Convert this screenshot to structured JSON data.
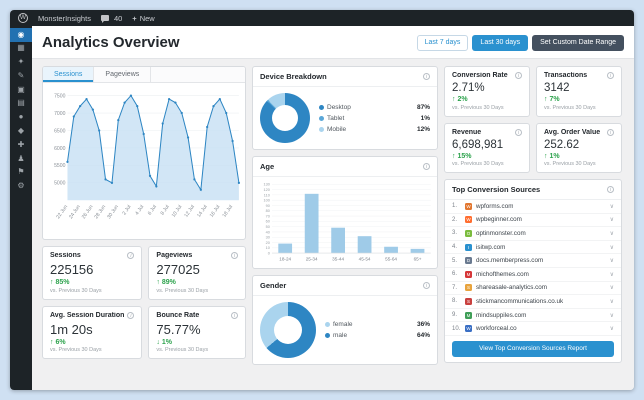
{
  "admin_bar": {
    "site_name": "MonsterInsights",
    "comments_count": "40",
    "new_label": "New"
  },
  "icons": {
    "wp": "W",
    "plus": "+",
    "info": "i",
    "chevron": "∨",
    "up_arrow": "↑",
    "down_arrow": "↓"
  },
  "sidebar": {
    "items": [
      {
        "name": "monsterinsights",
        "glyph": "◉",
        "active": true
      },
      {
        "name": "dashboard",
        "glyph": "▦",
        "active": false
      },
      {
        "name": "jetpack",
        "glyph": "✦",
        "active": false
      },
      {
        "name": "posts",
        "glyph": "✎",
        "active": false
      },
      {
        "name": "media",
        "glyph": "▣",
        "active": false
      },
      {
        "name": "pages",
        "glyph": "▤",
        "active": false
      },
      {
        "name": "comments",
        "glyph": "●",
        "active": false
      },
      {
        "name": "appearance",
        "glyph": "◆",
        "active": false
      },
      {
        "name": "plugins",
        "glyph": "✚",
        "active": false
      },
      {
        "name": "users",
        "glyph": "♟",
        "active": false
      },
      {
        "name": "tools",
        "glyph": "⚑",
        "active": false
      },
      {
        "name": "settings",
        "glyph": "⚙",
        "active": false
      }
    ]
  },
  "header": {
    "title": "Analytics Overview",
    "range_buttons": [
      {
        "label": "Last 7 days",
        "active": false
      },
      {
        "label": "Last 30 days",
        "active": true
      }
    ],
    "custom_range_label": "Set Custom Date Range"
  },
  "tabs": [
    {
      "label": "Sessions",
      "active": true
    },
    {
      "label": "Pageviews",
      "active": false
    }
  ],
  "stats": {
    "cards": [
      {
        "label": "Sessions",
        "value": "225156",
        "delta": "85%",
        "direction": "up",
        "compare": "vs. Previous 30 Days"
      },
      {
        "label": "Pageviews",
        "value": "277025",
        "delta": "89%",
        "direction": "up",
        "compare": "vs. Previous 30 Days"
      },
      {
        "label": "Avg. Session Duration",
        "value": "1m 20s",
        "delta": "6%",
        "direction": "up",
        "compare": "vs. Previous 30 Days"
      },
      {
        "label": "Bounce Rate",
        "value": "75.77%",
        "delta": "1%",
        "direction": "down",
        "compare": "vs. Previous 30 Days"
      }
    ]
  },
  "ecommerce": {
    "cards": [
      {
        "label": "Conversion Rate",
        "value": "2.71%",
        "delta": "2%",
        "direction": "up",
        "compare": "vs. Previous 30 Days"
      },
      {
        "label": "Transactions",
        "value": "3142",
        "delta": "7%",
        "direction": "up",
        "compare": "vs. Previous 30 Days"
      },
      {
        "label": "Revenue",
        "value": "6,698,981",
        "delta": "15%",
        "direction": "up",
        "compare": "vs. Previous 30 Days"
      },
      {
        "label": "Avg. Order Value",
        "value": "252.62",
        "delta": "1%",
        "direction": "up",
        "compare": "vs. Previous 30 Days"
      }
    ]
  },
  "panels": {
    "device": {
      "title": "Device Breakdown"
    },
    "age": {
      "title": "Age"
    },
    "gender": {
      "title": "Gender"
    }
  },
  "sources": {
    "title": "Top Conversion Sources",
    "items": [
      {
        "rank": "1",
        "domain": "wpforms.com",
        "color": "#e27730"
      },
      {
        "rank": "2",
        "domain": "wpbeginner.com",
        "color": "#ff6e30"
      },
      {
        "rank": "3",
        "domain": "optinmonster.com",
        "color": "#7bbc3e"
      },
      {
        "rank": "4",
        "domain": "isitwp.com",
        "color": "#2a91cf"
      },
      {
        "rank": "5",
        "domain": "docs.memberpress.com",
        "color": "#6a7a90"
      },
      {
        "rank": "6",
        "domain": "michofthemes.com",
        "color": "#d63638"
      },
      {
        "rank": "7",
        "domain": "shareasale-analytics.com",
        "color": "#e8a33d"
      },
      {
        "rank": "8",
        "domain": "stickmancommunications.co.uk",
        "color": "#c9413f"
      },
      {
        "rank": "9",
        "domain": "mindsuppiles.com",
        "color": "#3f9e57"
      },
      {
        "rank": "10",
        "domain": "workforceal.co",
        "color": "#3a6fc4"
      }
    ],
    "footer_button": "View Top Conversion Sources Report"
  },
  "colors": {
    "accent_blue": "#2a91cf",
    "wp_admin_blue": "#2271b1",
    "positive_green": "#2ca24c",
    "dark_button": "#44505f"
  },
  "chart_data": [
    {
      "id": "sessions",
      "type": "area",
      "title": "Sessions",
      "x_tick_labels": [
        "22 Jun",
        "24 Jun",
        "26 Jun",
        "28 Jun",
        "30 Jun",
        "2 Jul",
        "4 Jul",
        "6 Jul",
        "8 Jul",
        "10 Jul",
        "12 Jul",
        "14 Jul",
        "16 Jul",
        "18 Jul"
      ],
      "x_tick_every": 2,
      "values": [
        5600,
        6900,
        7200,
        7400,
        7100,
        6500,
        5100,
        5000,
        6800,
        7300,
        7500,
        7200,
        6400,
        5200,
        4900,
        6700,
        7400,
        7300,
        7000,
        6300,
        5100,
        4800,
        6600,
        7200,
        7400,
        7000,
        6200,
        5000
      ],
      "ylim": [
        4500,
        7600
      ],
      "yticks": [
        5000,
        5500,
        6000,
        6500,
        7000,
        7500
      ],
      "line_color": "#2e86c3",
      "fill_color": "#c7e0f4"
    },
    {
      "id": "age",
      "type": "bar",
      "title": "Age",
      "categories": [
        "18-24",
        "25-34",
        "35-44",
        "45-54",
        "55-64",
        "65+"
      ],
      "values": [
        18,
        112,
        48,
        32,
        12,
        8
      ],
      "ylim": [
        0,
        130
      ],
      "ytick_step": 10,
      "bar_color": "#9fcbe8"
    },
    {
      "id": "device",
      "type": "pie",
      "title": "Device Breakdown",
      "start_angle": 0,
      "segments": [
        {
          "label": "Desktop",
          "value": 87,
          "color": "#2e86c3"
        },
        {
          "label": "Tablet",
          "value": 1,
          "color": "#5aa7d8"
        },
        {
          "label": "Mobile",
          "value": 12,
          "color": "#aad4ee"
        }
      ]
    },
    {
      "id": "gender",
      "type": "pie",
      "title": "Gender",
      "start_angle": 230,
      "segments": [
        {
          "label": "female",
          "value": 36,
          "color": "#aad4ee"
        },
        {
          "label": "male",
          "value": 64,
          "color": "#2e86c3"
        }
      ]
    }
  ]
}
